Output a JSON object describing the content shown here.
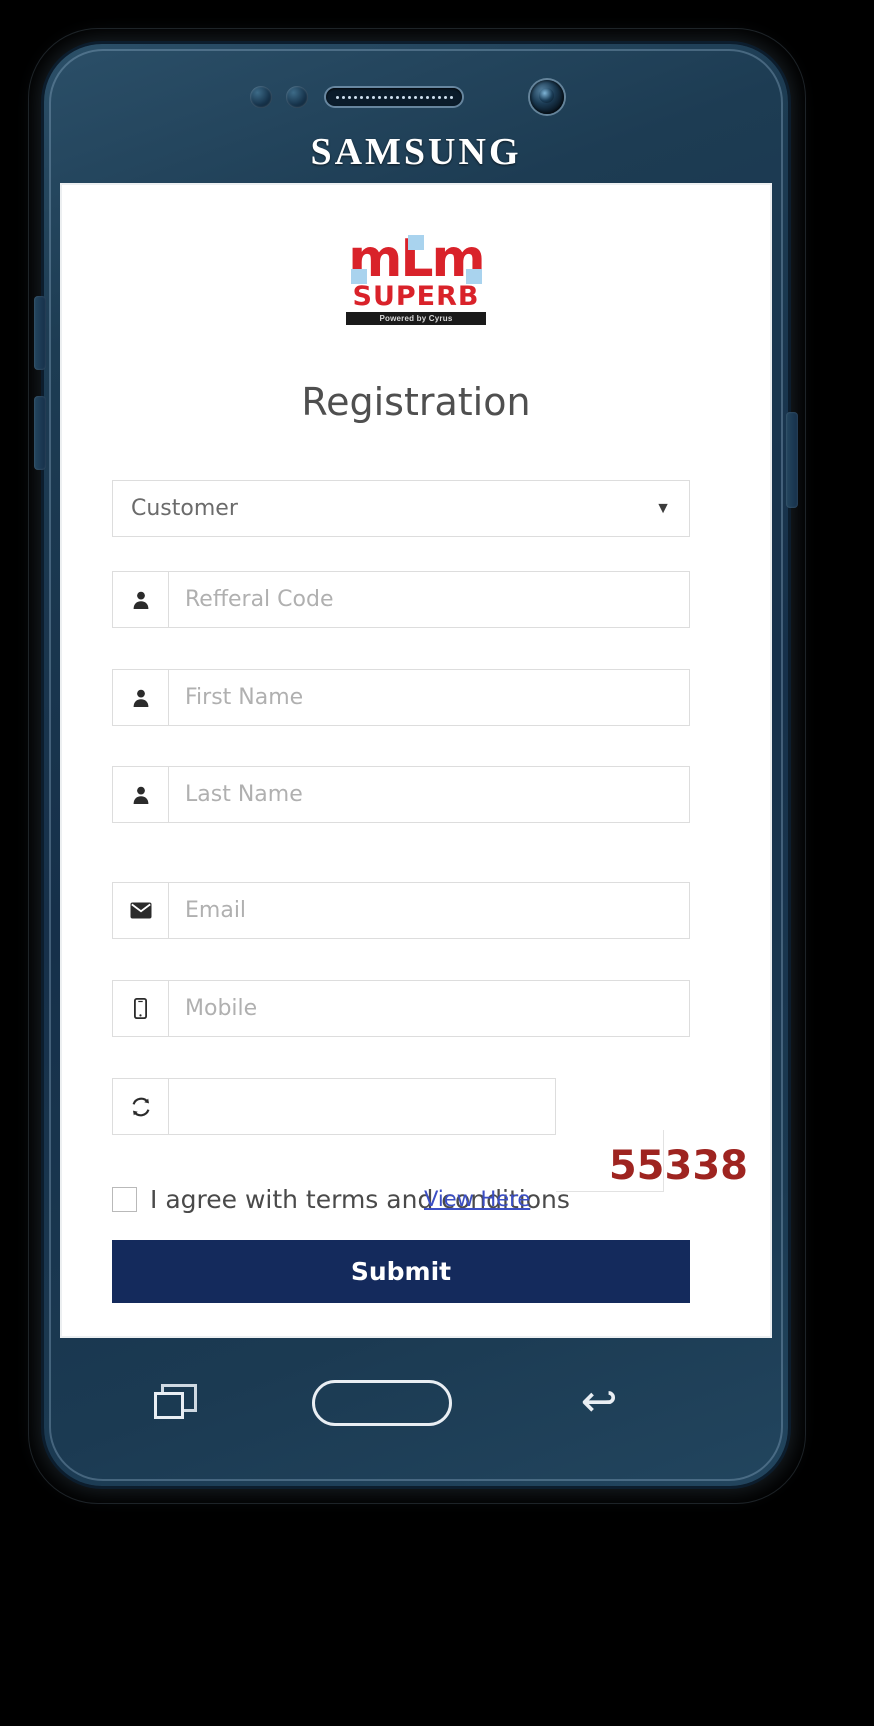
{
  "device": {
    "brand": "SAMSUNG",
    "bezel_color": "#1b3a52",
    "nav": {
      "recent_apps_label": "recent-apps",
      "home_label": "home",
      "back_label": "↩"
    }
  },
  "logo": {
    "wordmark": "mLm",
    "subtitle": "SUPERB",
    "powered_by": "Powered by Cyrus",
    "primary_color": "#d9222a",
    "accent_color": "#a9d3ee"
  },
  "page": {
    "title": "Registration"
  },
  "form": {
    "role_select": {
      "selected": "Customer",
      "caret": "▼",
      "options": [
        "Customer"
      ]
    },
    "fields": [
      {
        "name": "referral",
        "icon": "user-icon",
        "glyph": "👤",
        "placeholder": "Refferal Code",
        "value": ""
      },
      {
        "name": "first_name",
        "icon": "user-icon",
        "glyph": "👤",
        "placeholder": "First Name",
        "value": ""
      },
      {
        "name": "last_name",
        "icon": "user-icon",
        "glyph": "👤",
        "placeholder": "Last Name",
        "value": ""
      },
      {
        "name": "email",
        "icon": "envelope-icon",
        "glyph": "✉",
        "placeholder": "Email",
        "value": ""
      },
      {
        "name": "mobile",
        "icon": "mobile-phone-icon",
        "glyph": "📱",
        "placeholder": "Mobile",
        "value": ""
      }
    ],
    "captcha": {
      "icon": "refresh-icon",
      "glyph": "↻",
      "placeholder": "",
      "value": "",
      "code": "55338",
      "code_color": "#9e2420"
    },
    "terms": {
      "checked": false,
      "text": "I agree with terms and conditions",
      "link_text": "View Here",
      "link_color": "#3b4ec4"
    },
    "submit": {
      "label": "Submit",
      "color": "#142a5c"
    }
  }
}
